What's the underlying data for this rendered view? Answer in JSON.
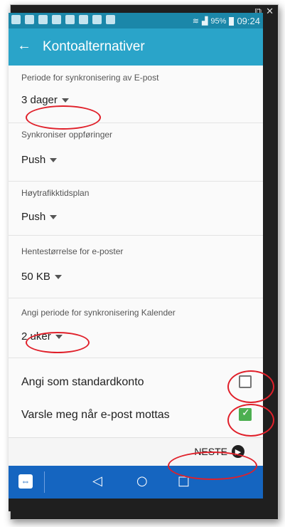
{
  "window": {
    "popout_icon": "popout-icon",
    "close_icon": "close-icon"
  },
  "statusbar": {
    "battery": "95%",
    "time": "09:24"
  },
  "appbar": {
    "title": "Kontoalternativer"
  },
  "settings": [
    {
      "label": "Periode for synkronisering av E-post",
      "value": "3 dager"
    },
    {
      "label": "Synkroniser oppføringer",
      "value": "Push"
    },
    {
      "label": "Høytrafikktidsplan",
      "value": "Push"
    },
    {
      "label": "Hentestørrelse for e-poster",
      "value": "50 KB"
    },
    {
      "label": "Angi periode for synkronisering Kalender",
      "value": "2 uker"
    }
  ],
  "checkboxes": [
    {
      "label": "Angi som standardkonto",
      "checked": false
    },
    {
      "label": "Varsle meg når e-post mottas",
      "checked": true
    }
  ],
  "footer": {
    "next_label": "NESTE"
  },
  "colors": {
    "status": "#1b87a9",
    "appbar": "#2aa4c9",
    "navbar": "#1565c0",
    "check": "#4caf50",
    "highlight": "#e0202a"
  }
}
